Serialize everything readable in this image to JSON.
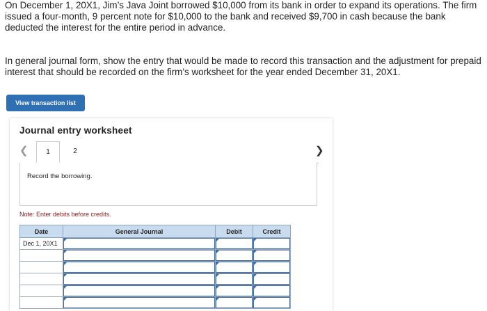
{
  "problem": {
    "paragraph1": "On December 1, 20X1, Jim’s Java Joint borrowed $10,000 from its bank in order to expand its operations. The firm issued a four-month, 9 percent note for $10,000 to the bank and received $9,700 in cash because the bank deducted the interest for the entire period in advance.",
    "paragraph2": "In general journal form, show the entry that would be made to record this transaction and the adjustment for prepaid interest that should be recorded on the firm’s worksheet for the year ended December 31, 20X1."
  },
  "view_transaction_button": "View transaction list",
  "worksheet": {
    "title": "Journal entry worksheet",
    "prev_icon": "chevron-left-icon",
    "next_icon": "chevron-right-icon",
    "tabs": [
      "1",
      "2"
    ],
    "active_tab": "1",
    "instruction": "Record the borrowing.",
    "note": "Note: Enter debits before credits.",
    "table": {
      "headers": [
        "Date",
        "General Journal",
        "Debit",
        "Credit"
      ],
      "rows": [
        {
          "date": "Dec 1, 20X1",
          "account": "",
          "debit": "",
          "credit": ""
        },
        {
          "date": "",
          "account": "",
          "debit": "",
          "credit": ""
        },
        {
          "date": "",
          "account": "",
          "debit": "",
          "credit": ""
        },
        {
          "date": "",
          "account": "",
          "debit": "",
          "credit": ""
        },
        {
          "date": "",
          "account": "",
          "debit": "",
          "credit": ""
        },
        {
          "date": "",
          "account": "",
          "debit": "",
          "credit": ""
        }
      ]
    }
  },
  "colors": {
    "button": "#2f6fb4",
    "header_bg": "#c9dcef",
    "note_text": "#8b1a1a"
  }
}
